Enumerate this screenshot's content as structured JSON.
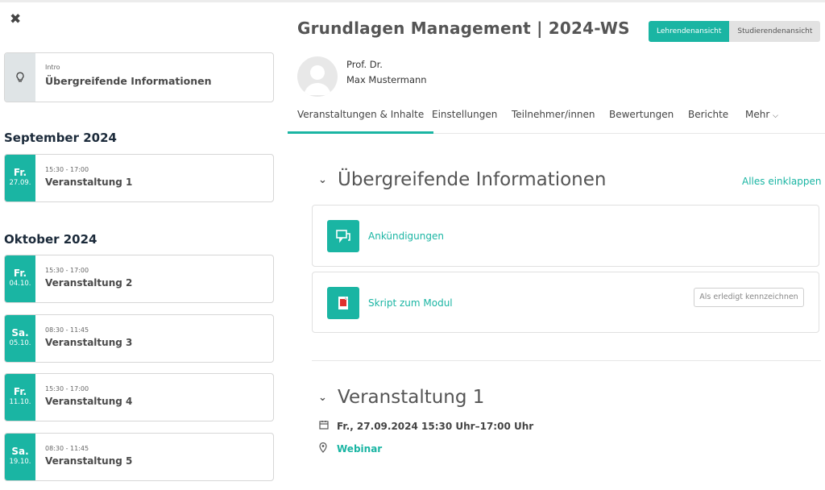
{
  "drawer": {
    "close_icon": "close-icon",
    "intro": {
      "kicker": "Intro",
      "title": "Übergreifende Informationen",
      "icon": "lightbulb-icon"
    },
    "months": [
      {
        "label": "September 2024"
      },
      {
        "label": "Oktober 2024"
      }
    ],
    "events": [
      {
        "dow": "Fr.",
        "dm": "27.09.",
        "time": "15:30 - 17:00",
        "title": "Veranstaltung 1"
      },
      {
        "dow": "Fr.",
        "dm": "04.10.",
        "time": "15:30 - 17:00",
        "title": "Veranstaltung 2"
      },
      {
        "dow": "Sa.",
        "dm": "05.10.",
        "time": "08:30 - 11:45",
        "title": "Veranstaltung 3"
      },
      {
        "dow": "Fr.",
        "dm": "11.10.",
        "time": "15:30 - 17:00",
        "title": "Veranstaltung 4"
      },
      {
        "dow": "Sa.",
        "dm": "19.10.",
        "time": "08:30 - 11:45",
        "title": "Veranstaltung 5"
      }
    ]
  },
  "header": {
    "course_title": "Grundlagen Management | 2024-WS",
    "view_toggle": {
      "teacher": "Lehrendenansicht",
      "student": "Studierendenansicht",
      "active": "teacher"
    },
    "teacher": {
      "title": "Prof. Dr.",
      "name": "Max Mustermann"
    }
  },
  "tabs": [
    {
      "label": "Veranstaltungen & Inhalte",
      "active": true
    },
    {
      "label": "Einstellungen"
    },
    {
      "label": "Teilnehmer/innen"
    },
    {
      "label": "Bewertungen"
    },
    {
      "label": "Berichte"
    },
    {
      "label": "Mehr"
    }
  ],
  "sections": {
    "general": {
      "title": "Übergreifende Informationen",
      "collapse_all": "Alles einklappen",
      "activities": [
        {
          "label": "Ankündigungen",
          "icon": "forum-icon"
        },
        {
          "label": "Skript zum Modul",
          "icon": "pdf-icon",
          "completion": "Als erledigt kennzeichnen"
        }
      ]
    },
    "event1": {
      "title": "Veranstaltung 1",
      "datetime": "Fr., 27.09.2024 15:30 Uhr–17:00 Uhr",
      "location": "Webinar"
    }
  },
  "colors": {
    "accent": "#1ab5a3",
    "heading": "#1b2a3a",
    "stripe_grey": "#dfe4e6"
  }
}
